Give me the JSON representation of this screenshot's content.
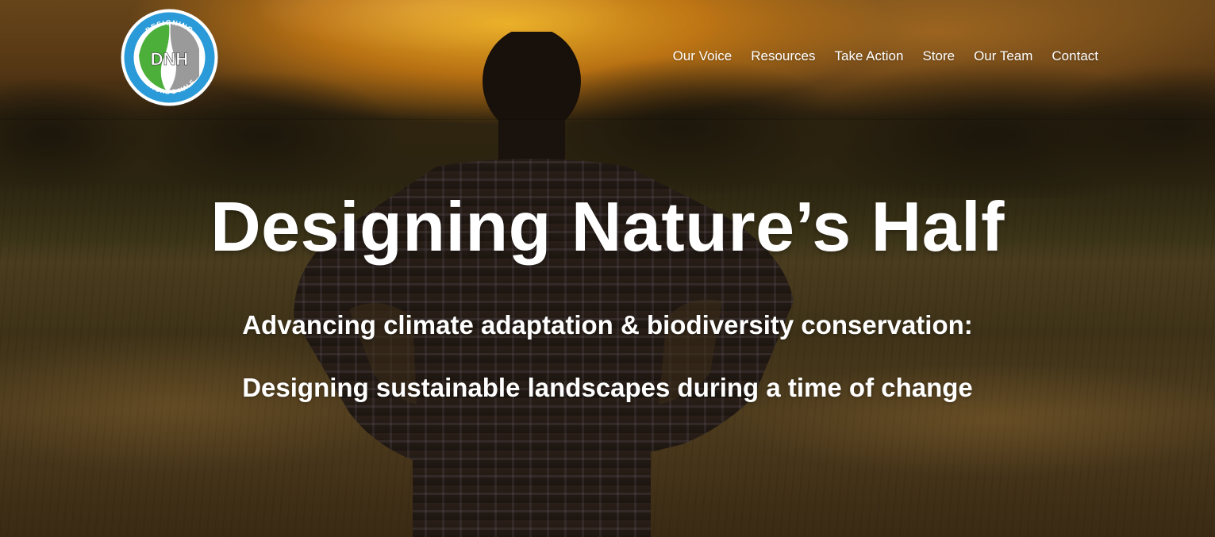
{
  "logo": {
    "top_text": "DESIGNING",
    "center_text": "DNH",
    "bottom_text": "NATURE'S HALF",
    "ring_color": "#2a9bd8",
    "leaf_color": "#4caf3a",
    "city_color": "#9a9a9a"
  },
  "nav": {
    "items": [
      {
        "label": "Our Voice"
      },
      {
        "label": "Resources"
      },
      {
        "label": "Take Action"
      },
      {
        "label": "Store"
      },
      {
        "label": "Our Team"
      },
      {
        "label": "Contact"
      }
    ]
  },
  "hero": {
    "title": "Designing Nature’s Half",
    "subtitle_line1": "Advancing climate adaptation & biodiversity conservation:",
    "subtitle_line2": "Designing sustainable landscapes during a time of change",
    "background_image": "silhouette of a person standing in a field at sunset"
  }
}
